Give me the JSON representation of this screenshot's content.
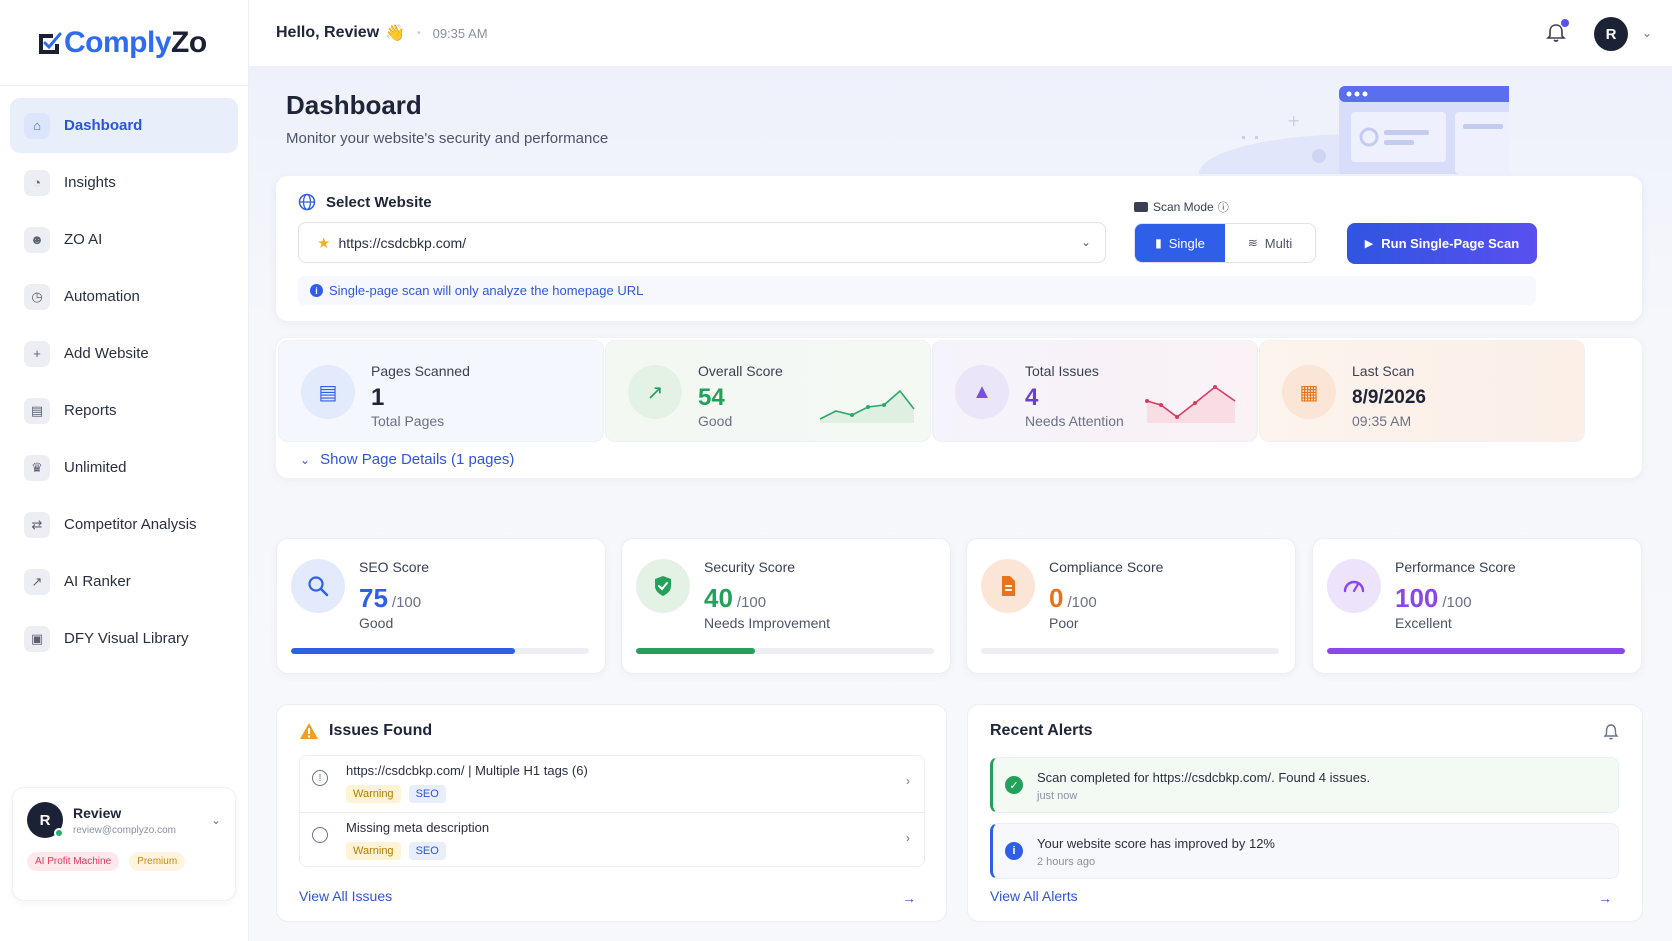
{
  "brand": {
    "name_part1": "Comply",
    "name_part2": "Zo"
  },
  "sidebar": {
    "items": [
      {
        "label": "Dashboard",
        "icon": "home-icon",
        "active": true
      },
      {
        "label": "Insights",
        "icon": "pie-chart-icon"
      },
      {
        "label": "ZO AI",
        "icon": "robot-icon"
      },
      {
        "label": "Automation",
        "icon": "clock-icon"
      },
      {
        "label": "Add Website",
        "icon": "plus-circle-icon"
      },
      {
        "label": "Reports",
        "icon": "document-icon"
      },
      {
        "label": "Unlimited",
        "icon": "crown-icon"
      },
      {
        "label": "Competitor Analysis",
        "icon": "swap-icon"
      },
      {
        "label": "AI Ranker",
        "icon": "line-chart-icon"
      },
      {
        "label": "DFY Visual Library",
        "icon": "gallery-icon"
      }
    ],
    "user": {
      "initial": "R",
      "name": "Review",
      "email": "review@complyzo.com",
      "badge_1": "AI Profit Machine",
      "badge_2": "Premium"
    }
  },
  "topbar": {
    "greeting": "Hello, Review",
    "wave": "👋",
    "time": "09:35 AM",
    "avatar_initial": "R"
  },
  "page": {
    "title": "Dashboard",
    "subtitle": "Monitor your website's security and performance"
  },
  "select_website": {
    "title": "Select Website",
    "url": "https://csdcbkp.com/",
    "scan_mode_label": "Scan Mode",
    "mode_single": "Single",
    "mode_multi": "Multi",
    "run_button": "Run Single-Page Scan",
    "info": "Single-page scan will only analyze the homepage URL"
  },
  "stats": [
    {
      "label": "Pages Scanned",
      "value": "1",
      "sub": "Total Pages"
    },
    {
      "label": "Overall Score",
      "value": "54",
      "sub": "Good"
    },
    {
      "label": "Total Issues",
      "value": "4",
      "sub": "Needs Attention"
    },
    {
      "label": "Last Scan",
      "value": "8/9/2026",
      "sub": "09:35 AM"
    }
  ],
  "show_details": "Show Page Details (1 pages)",
  "scores": [
    {
      "label": "SEO Score",
      "value": "75",
      "max": "/100",
      "status": "Good",
      "percent": 75,
      "color": "#2f5fe8"
    },
    {
      "label": "Security Score",
      "value": "40",
      "max": "/100",
      "status": "Needs Improvement",
      "percent": 40,
      "color": "#23a05a"
    },
    {
      "label": "Compliance Score",
      "value": "0",
      "max": "/100",
      "status": "Poor",
      "percent": 0,
      "color": "#e8731a"
    },
    {
      "label": "Performance Score",
      "value": "100",
      "max": "/100",
      "status": "Excellent",
      "percent": 100,
      "color": "#8a47f0"
    }
  ],
  "issues": {
    "title": "Issues Found",
    "rows": [
      {
        "text": "https://csdcbkp.com/ | Multiple H1 tags (6)",
        "tag1": "Warning",
        "tag2": "SEO"
      },
      {
        "text": "Missing meta description",
        "tag1": "Warning",
        "tag2": "SEO"
      }
    ],
    "view_all": "View All Issues"
  },
  "alerts": {
    "title": "Recent Alerts",
    "items": [
      {
        "text": "Scan completed for https://csdcbkp.com/. Found 4 issues.",
        "time": "just now"
      },
      {
        "text": "Your website score has improved by 12%",
        "time": "2 hours ago"
      }
    ],
    "view_all": "View All Alerts"
  },
  "colors": {
    "accent": "#2f5fe8",
    "success": "#23a05a",
    "warning": "#e8731a",
    "purple": "#8a47f0"
  }
}
